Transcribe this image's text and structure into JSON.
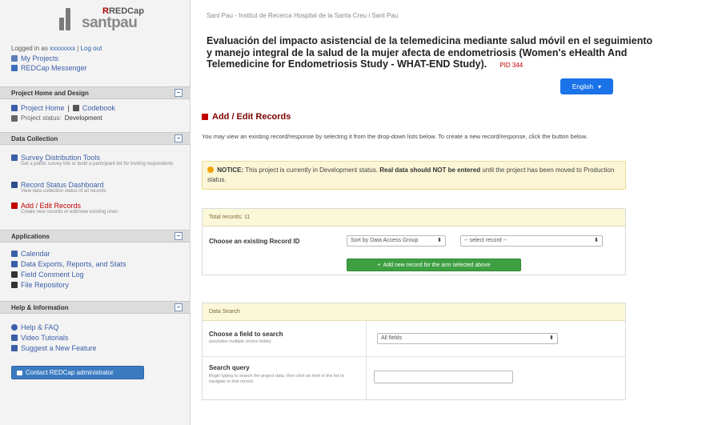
{
  "sidebar": {
    "logo": {
      "brand_top": "REDCap",
      "brand_name": "santpau"
    },
    "login": {
      "text": "Logged in as",
      "user": "xxxxxxxx",
      "logout": "Log out"
    },
    "my_projects": "My Projects",
    "redcap_messenger": "REDCap Messenger",
    "sections": {
      "project_home": "Project Home and Design",
      "data_collection": "Data Collection",
      "applications": "Applications",
      "help": "Help & Information"
    },
    "project_home_link": "Project Home",
    "codebook_link": "Codebook",
    "project_status_label": "Project status:",
    "project_status_value": "Development",
    "data_collection_items": [
      {
        "label": "Survey Distribution Tools",
        "desc": "Get a public survey link or build a participant list for inviting respondents"
      },
      {
        "label": "Record Status Dashboard",
        "desc": "View data collection status of all records"
      },
      {
        "label": "Add / Edit Records",
        "desc": "Create new records or edit/view existing ones"
      }
    ],
    "application_items": [
      "Calendar",
      "Data Exports, Reports, and Stats",
      "Field Comment Log",
      "File Repository"
    ],
    "help_items": [
      "Help & FAQ",
      "Video Tutorials",
      "Suggest a New Feature"
    ],
    "contact_button": "Contact REDCap administrator"
  },
  "main": {
    "breadcrumb": "Sant Pau - Institut de Recerca Hospital de la Santa Creu i Sant Pau",
    "title": "Evaluación del impacto asistencial de la telemedicina mediante salud móvil en el seguimiento y manejo integral de la salud de la mujer afecta de endometriosis (Women's eHealth And Telemedicine for Endometriosis Study - WHAT-END Study).",
    "project_id": "PID 344",
    "language_button": "English",
    "section_title": "Add / Edit Records",
    "instructions": "You may view an existing record/response by selecting it from the drop-down lists below. To create a new record/response, click the button below.",
    "notice_label": "NOTICE:",
    "notice_text": "This project is currently in Development status.",
    "notice_bold": "Real data should NOT be entered",
    "notice_tail": "until the project has been moved to Production status.",
    "panel1": {
      "header": "Total records: 11",
      "choose_label": "Choose an existing Record ID",
      "select_status": "Sort by Data Access Group",
      "select_record": "-- select record --",
      "add_button": "Add new record for the arm selected above"
    },
    "panel2": {
      "header": "Data Search",
      "field_label": "Choose a field to search",
      "field_sub": "(excludes multiple choice fields)",
      "field_select": "All fields",
      "query_label": "Search query",
      "query_sub": "Begin typing to search the project data, then click an item in the list to navigate to that record."
    }
  },
  "colors": {
    "accent_blue": "#1a73e8",
    "link_blue": "#3b5ea8",
    "dark_red": "#800000",
    "green": "#3ea042",
    "notice_bg": "#fcf6d7"
  }
}
